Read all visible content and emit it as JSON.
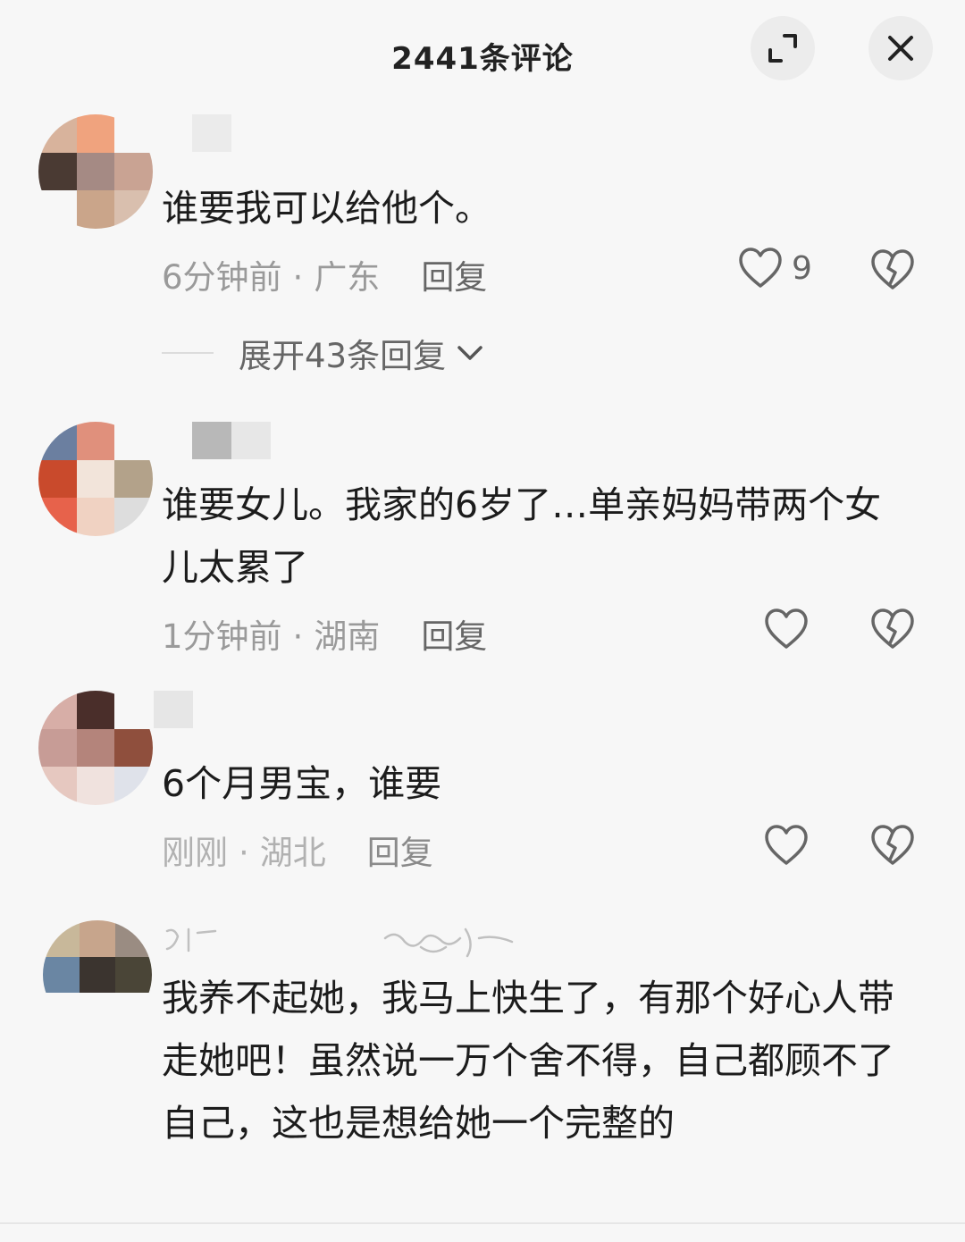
{
  "header": {
    "title": "2441条评论"
  },
  "comments": [
    {
      "text": "谁要我可以给他个。",
      "time": "6分钟前",
      "location": "广东",
      "reply_label": "回复",
      "likes": "9",
      "expand_label": "展开43条回复"
    },
    {
      "text": "谁要女儿。我家的6岁了…单亲妈妈带两个女儿太累了",
      "time": "1分钟前",
      "location": "湖南",
      "reply_label": "回复"
    },
    {
      "text": "6个月男宝，谁要",
      "time": "刚刚",
      "location": "湖北",
      "reply_label": "回复"
    },
    {
      "text": "我养不起她，我马上快生了，有那个好心人带走她吧！虽然说一万个舍不得，自己都顾不了自己，这也是想给她一个完整的"
    }
  ]
}
